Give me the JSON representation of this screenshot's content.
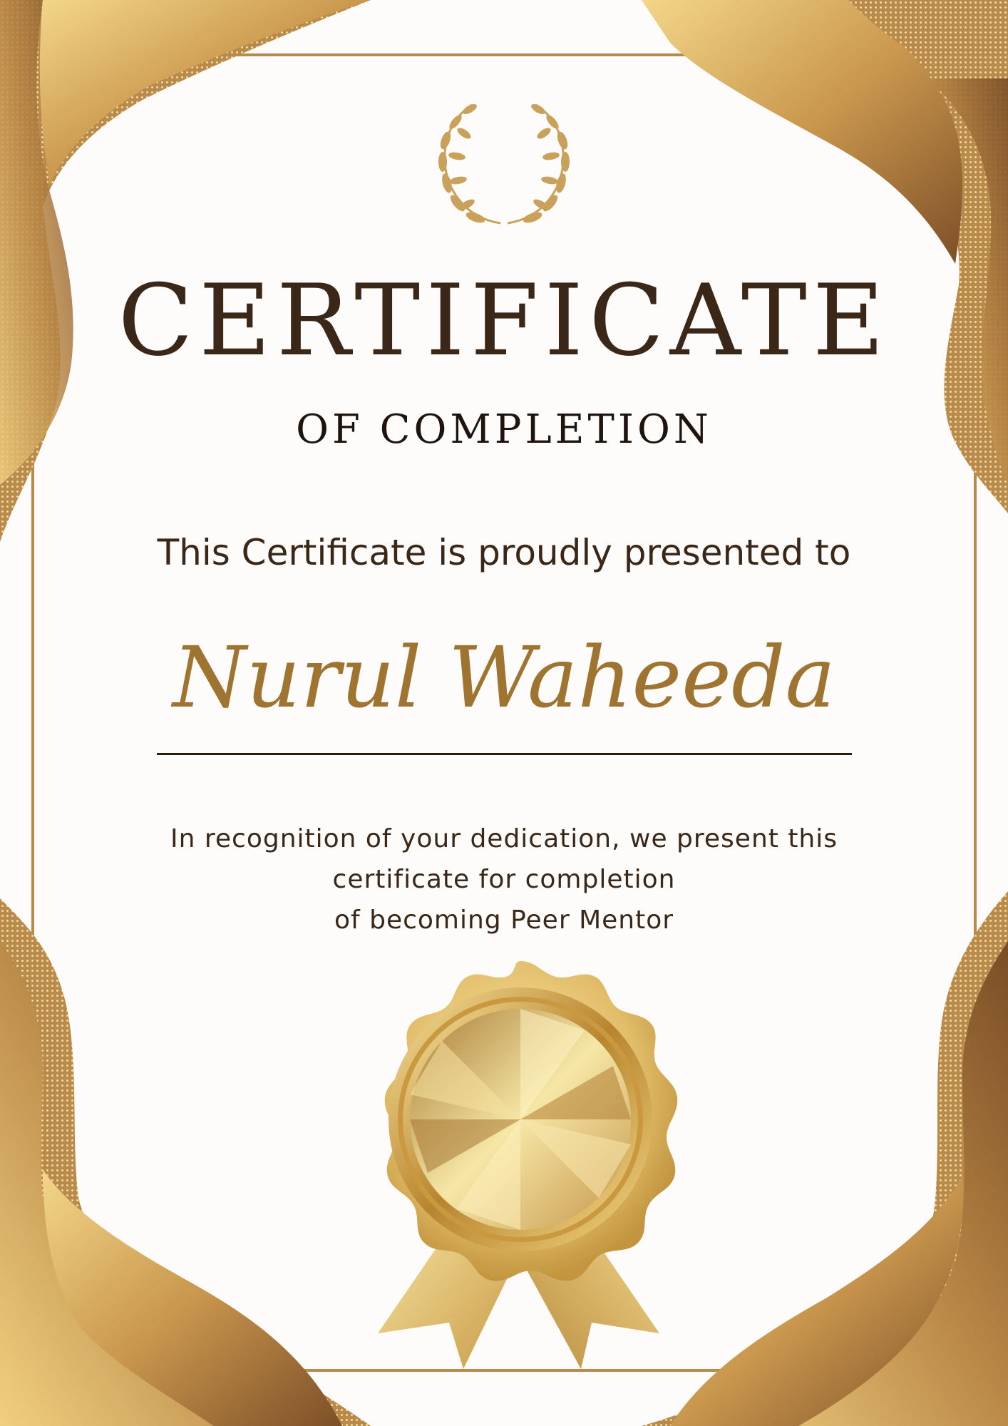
{
  "certificate": {
    "title": "CERTIFICATE",
    "subtitle": "OF COMPLETION",
    "presented_to": "This Certificate is proudly presented to",
    "recipient_name": "Nurul Waheeda",
    "recognition_lines": [
      "In recognition of your dedication, we present this",
      "certificate for completion",
      "of becoming Peer Mentor"
    ]
  },
  "icons": {
    "top_emblem": "laurel-wreath-icon",
    "seal": "gold-medal-seal-icon"
  },
  "colors": {
    "background": "#fdfcfa",
    "gold": "#c9a156",
    "gold_light": "#f3df9a",
    "gold_dark": "#8a5a2d",
    "title_text": "#3b2718",
    "name_text": "#9f7430"
  }
}
